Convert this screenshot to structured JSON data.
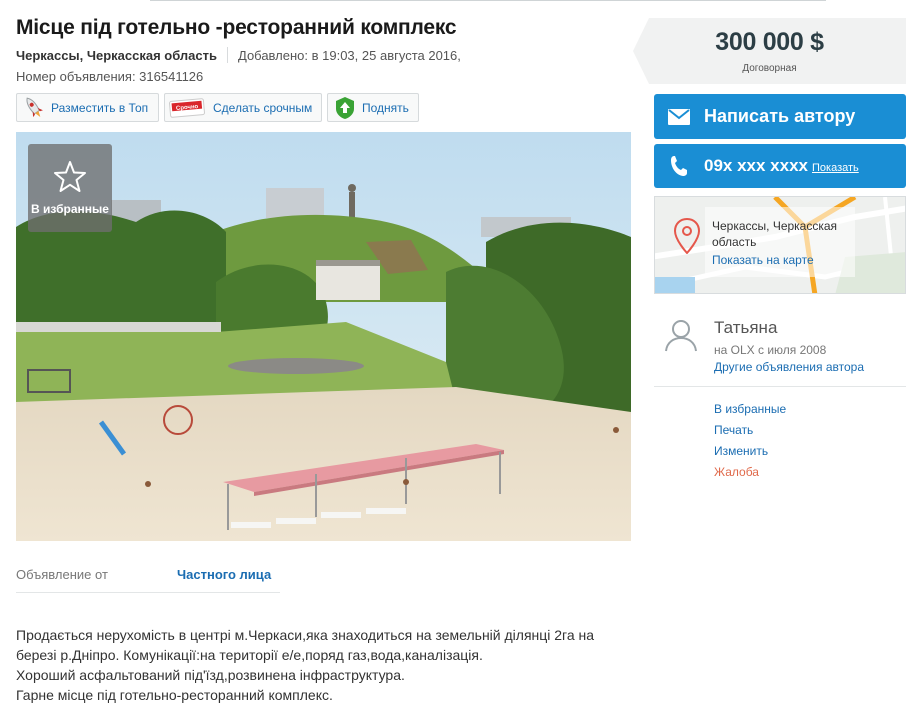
{
  "ad": {
    "title": "Місце під готельно -ресторанний комплекс",
    "location": "Черкассы, Черкасская область",
    "added": "Добавлено: в 19:03, 25 августа 2016,",
    "ad_number": "Номер объявления: 316541126"
  },
  "promo": {
    "top_label": "Разместить в Топ",
    "urgent_label": "Сделать срочным",
    "urgent_sticker": "Срочно",
    "up_label": "Поднять"
  },
  "photo": {
    "favorite_label": "В избранные"
  },
  "details": {
    "offer_from_label": "Объявление от",
    "offer_from_value": "Частного лица"
  },
  "description": [
    "Продається нерухомість в центрі м.Черкаси,яка знаходиться на земельній ділянці 2га на",
    "березі р.Дніпро. Комунікації:на території е/е,поряд газ,вода,каналізація.",
    "Хороший асфальтований під'їзд,розвинена інфраструктура.",
    "Гарне місце під готельно-ресторанний комплекс."
  ],
  "sidebar": {
    "price": "300 000 $",
    "price_note": "Договорная",
    "write_button": "Написать автору",
    "phone": "09x xxx xxxx",
    "phone_show": "Показать",
    "map_location": "Черкассы, Черкасская область",
    "map_link": "Показать на карте",
    "user_name": "Татьяна",
    "user_since": "на OLX с июля 2008",
    "user_other_ads": "Другие объявления автора",
    "actions": {
      "favorite": "В избранные",
      "print": "Печать",
      "edit": "Изменить",
      "report": "Жалоба"
    }
  },
  "colors": {
    "accent_blue": "#1a8ed4",
    "link_blue": "#1b6db2",
    "report_red": "#e06a4b",
    "price_bg": "#f1f2f2"
  }
}
